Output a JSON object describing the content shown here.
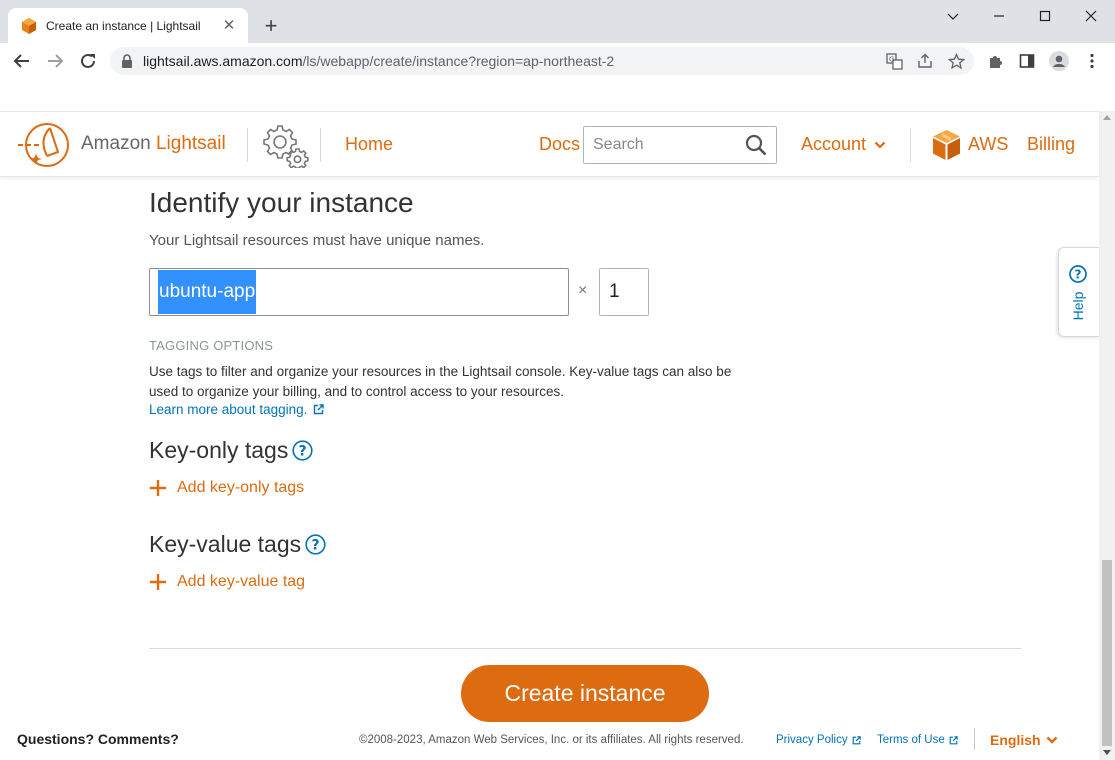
{
  "browser": {
    "tab_title": "Create an instance | Lightsail",
    "url_host": "lightsail.aws.amazon.com",
    "url_path": "/ls/webapp/create/instance?region=ap-northeast-2",
    "new_tab_label": "+"
  },
  "header": {
    "brand_prefix": "Amazon",
    "brand_name": "Lightsail",
    "home": "Home",
    "docs": "Docs",
    "search_placeholder": "Search",
    "account": "Account",
    "aws": "AWS",
    "billing": "Billing"
  },
  "identify": {
    "title": "Identify your instance",
    "subtitle": "Your Lightsail resources must have unique names.",
    "instance_name": "ubuntu-app",
    "multiplier": "×",
    "quantity": "1"
  },
  "tagging": {
    "section_label": "TAGGING OPTIONS",
    "description": "Use tags to filter and organize your resources in the Lightsail console. Key-value tags can also be used to organize your billing, and to control access to your resources.",
    "learn_more": "Learn more about tagging.",
    "key_only_title": "Key-only tags",
    "add_key_only": "Add key-only tags",
    "key_value_title": "Key-value tags",
    "add_key_value": "Add key-value tag"
  },
  "actions": {
    "create": "Create instance"
  },
  "help": {
    "label": "Help"
  },
  "footer": {
    "questions": "Questions? Comments?",
    "copyright": "©2008-2023, Amazon Web Services, Inc. or its affiliates. All rights reserved.",
    "privacy": "Privacy Policy",
    "terms": "Terms of Use",
    "language": "English"
  },
  "colors": {
    "accent": "#dd6b10",
    "link": "#0073bb",
    "selection": "#3390ff",
    "chrome_tabbar": "#dee1e6"
  },
  "icons": [
    "lightsail-logo-icon",
    "settings-gear-icon",
    "search-icon",
    "chevron-down-icon",
    "aws-cube-icon",
    "external-link-icon",
    "question-circle-icon",
    "plus-icon",
    "lock-icon",
    "translate-icon",
    "share-icon",
    "star-icon",
    "extensions-icon",
    "side-panel-icon",
    "profile-icon",
    "menu-icon"
  ]
}
